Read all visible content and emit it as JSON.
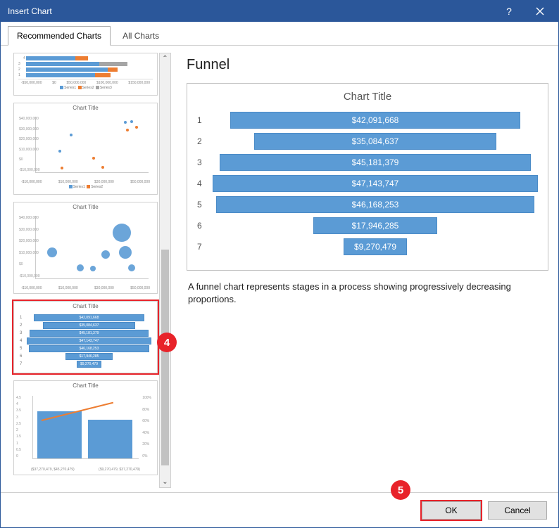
{
  "window": {
    "title": "Insert Chart",
    "help": "?",
    "close": "×"
  },
  "tabs": {
    "recommended": "Recommended Charts",
    "all": "All Charts"
  },
  "thumbnails": {
    "title_generic": "Chart Title",
    "bar_legend": [
      "Series1",
      "Series2",
      "Series3"
    ],
    "scatter_legend": [
      "Series1",
      "Series2"
    ],
    "bar_xticks": [
      "-$50,000,000",
      "$0",
      "$50,000,000",
      "$100,000,000",
      "$150,000,000"
    ],
    "scatter_xticks": [
      "-$10,000,000",
      "$10,000,000",
      "$30,000,000",
      "$50,000,000"
    ],
    "bubble_xticks": [
      "-$10,000,000",
      "$10,000,000",
      "$30,000,000",
      "$50,000,000"
    ],
    "combo_xticks": [
      "($37,270,479, $45,270,479)",
      "($9,270,479, $37,270,479)"
    ],
    "y_money": [
      "$40,000,000",
      "$30,000,000",
      "$20,000,000",
      "$10,000,000",
      "$0",
      "-$10,000,000"
    ],
    "funnel_labels": [
      "1",
      "2",
      "3",
      "4",
      "5",
      "6",
      "7"
    ],
    "funnel_vals": [
      "$42,091,668",
      "$35,084,637",
      "$45,181,379",
      "$47,143,747",
      "$46,168,253",
      "$17,946,285",
      "$9,270,479"
    ]
  },
  "preview": {
    "section_title": "Funnel",
    "chart_title": "Chart Title",
    "description": "A funnel chart represents stages in a process showing progressively decreasing proportions."
  },
  "chart_data": {
    "type": "bar",
    "orientation": "funnel",
    "categories": [
      "1",
      "2",
      "3",
      "4",
      "5",
      "6",
      "7"
    ],
    "values": [
      42091668,
      35084637,
      45181379,
      47143747,
      46168253,
      17946285,
      9270479
    ],
    "labels": [
      "$42,091,668",
      "$35,084,637",
      "$45,181,379",
      "$47,143,747",
      "$46,168,253",
      "$17,946,285",
      "$9,270,479"
    ],
    "title": "Chart Title",
    "xlabel": "",
    "ylabel": "",
    "ylim": [
      0,
      47143747
    ]
  },
  "buttons": {
    "ok": "OK",
    "cancel": "Cancel"
  },
  "markers": {
    "four": "4",
    "five": "5"
  }
}
